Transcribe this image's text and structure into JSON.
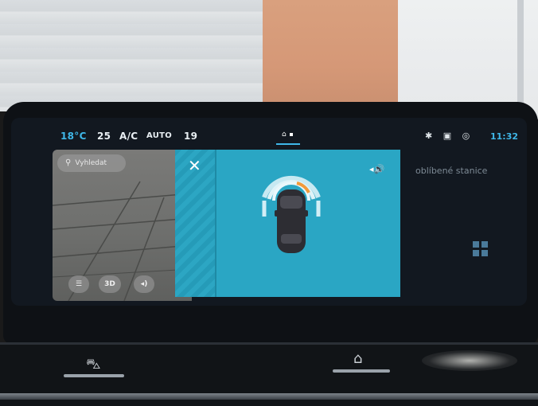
{
  "status_bar": {
    "temp_left": "18°C",
    "fan_speed": "25",
    "ac_label": "A/C",
    "auto_label": "AUTO",
    "temp_right": "19",
    "bluetooth_icon": "bluetooth-icon",
    "car_icon": "car-icon",
    "location_icon": "location-icon",
    "time": "11:32"
  },
  "map": {
    "search_placeholder": "Vyhledat",
    "btn_3d": "3D"
  },
  "parking": {
    "close_label": "✕",
    "sound_label": "◂🔊"
  },
  "home_right": {
    "title": "oblíbené stanice"
  },
  "colors": {
    "accent": "#3fb7e8",
    "panel": "#2aa6c4",
    "sensor_warning": "#f29a3a"
  }
}
